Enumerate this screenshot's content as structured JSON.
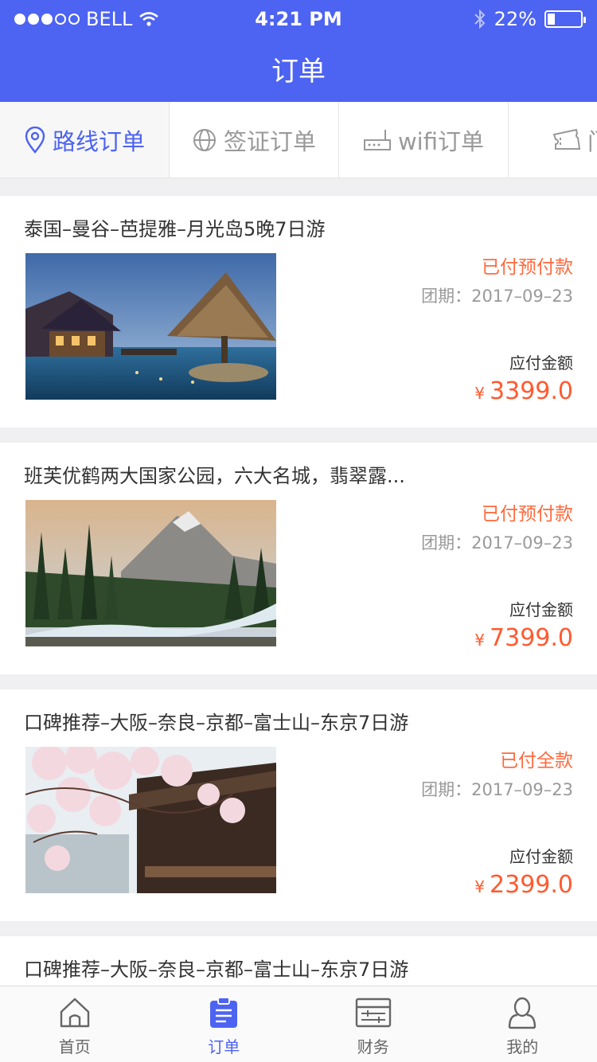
{
  "statusbar": {
    "carrier": "BELL",
    "time": "4:21 PM",
    "battery": "22%",
    "battery_level": 0.22
  },
  "header": {
    "title": "订单"
  },
  "tabs": [
    {
      "label": "路线订单",
      "icon": "location-pin-icon",
      "active": true
    },
    {
      "label": "签证订单",
      "icon": "globe-icon",
      "active": false
    },
    {
      "label": "wifi订单",
      "icon": "router-icon",
      "active": false
    },
    {
      "label": "门票",
      "icon": "ticket-icon",
      "active": false
    }
  ],
  "orders": [
    {
      "title": "泰国–曼谷–芭提雅–月光岛5晚7日游",
      "status": "已付预付款",
      "date": "团期：2017–09–23",
      "amount_label": "应付金额",
      "currency": "¥",
      "amount": "3399.0",
      "image": "thailand-resort-image"
    },
    {
      "title": "班芙优鹤两大国家公园，六大名城，翡翠露...",
      "status": "已付预付款",
      "date": "团期：2017–09–23",
      "amount_label": "应付金额",
      "currency": "¥",
      "amount": "7399.0",
      "image": "canada-mountain-river-image"
    },
    {
      "title": "口碑推荐–大阪–奈良–京都–富士山–东京7日游",
      "status": "已付全款",
      "date": "团期：2017–09–23",
      "amount_label": "应付金额",
      "currency": "¥",
      "amount": "2399.0",
      "image": "japan-cherry-blossom-image"
    },
    {
      "title": "口碑推荐–大阪–奈良–京都–富士山–东京7日游"
    }
  ],
  "tabbar": [
    {
      "label": "首页",
      "icon": "home-icon",
      "active": false
    },
    {
      "label": "订单",
      "icon": "order-list-icon",
      "active": true
    },
    {
      "label": "财务",
      "icon": "finance-icon",
      "active": false
    },
    {
      "label": "我的",
      "icon": "user-icon",
      "active": false
    }
  ],
  "colors": {
    "primary": "#4d63f2",
    "price": "#ff5a30",
    "status": "#ff6a3d"
  }
}
